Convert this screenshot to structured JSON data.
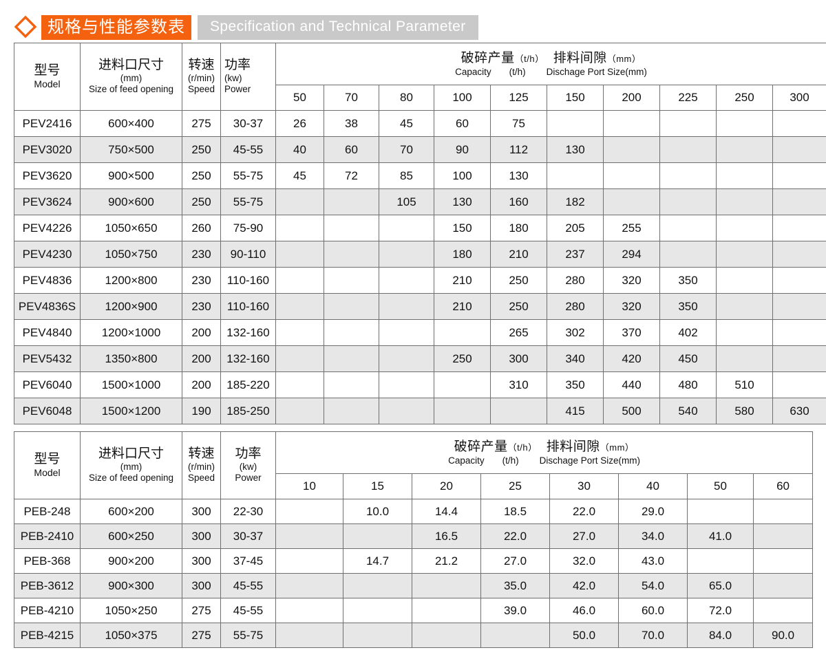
{
  "header": {
    "diamond_icon": "diamond-icon",
    "title_cn": "规格与性能参数表",
    "title_en": "Specification and Technical Parameter",
    "accent_color": "#f4620f",
    "banner_gray": "#c9c9c9"
  },
  "common_headers": {
    "model_cn": "型号",
    "model_en": "Model",
    "feed_cn": "进料口尺寸",
    "feed_unit": "(mm)",
    "feed_en": "Size of feed opening",
    "speed_cn": "转速",
    "speed_unit": "(r/min)",
    "speed_en": "Speed",
    "power_cn": "功率",
    "power_unit": "(kw)",
    "power_en": "Power",
    "capacity_cn": "破碎产量（t/h）",
    "capacity_cn_a": "破碎产量",
    "capacity_cn_unit": "（t/h）",
    "discharge_cn_a": "排料间隙",
    "discharge_cn_unit": "（mm）",
    "capacity_en": "Capacity",
    "capacity_en_unit": "(t/h)",
    "discharge_en": "Dischage Port Size(mm)"
  },
  "table1": {
    "gap_columns": [
      "50",
      "70",
      "80",
      "100",
      "125",
      "150",
      "200",
      "225",
      "250",
      "300"
    ],
    "rows": [
      {
        "model": "PEV2416",
        "feed": "600×400",
        "speed": "275",
        "power": "30-37",
        "values": [
          "26",
          "38",
          "45",
          "60",
          "75",
          "",
          "",
          "",
          "",
          ""
        ]
      },
      {
        "model": "PEV3020",
        "feed": "750×500",
        "speed": "250",
        "power": "45-55",
        "values": [
          "40",
          "60",
          "70",
          "90",
          "112",
          "130",
          "",
          "",
          "",
          ""
        ]
      },
      {
        "model": "PEV3620",
        "feed": "900×500",
        "speed": "250",
        "power": "55-75",
        "values": [
          "45",
          "72",
          "85",
          "100",
          "130",
          "",
          "",
          "",
          "",
          ""
        ]
      },
      {
        "model": "PEV3624",
        "feed": "900×600",
        "speed": "250",
        "power": "55-75",
        "values": [
          "",
          "",
          "105",
          "130",
          "160",
          "182",
          "",
          "",
          "",
          ""
        ]
      },
      {
        "model": "PEV4226",
        "feed": "1050×650",
        "speed": "260",
        "power": "75-90",
        "values": [
          "",
          "",
          "",
          "150",
          "180",
          "205",
          "255",
          "",
          "",
          ""
        ]
      },
      {
        "model": "PEV4230",
        "feed": "1050×750",
        "speed": "230",
        "power": "90-110",
        "values": [
          "",
          "",
          "",
          "180",
          "210",
          "237",
          "294",
          "",
          "",
          ""
        ]
      },
      {
        "model": "PEV4836",
        "feed": "1200×800",
        "speed": "230",
        "power": "110-160",
        "values": [
          "",
          "",
          "",
          "210",
          "250",
          "280",
          "320",
          "350",
          "",
          ""
        ]
      },
      {
        "model": "PEV4836S",
        "feed": "1200×900",
        "speed": "230",
        "power": "110-160",
        "values": [
          "",
          "",
          "",
          "210",
          "250",
          "280",
          "320",
          "350",
          "",
          ""
        ]
      },
      {
        "model": "PEV4840",
        "feed": "1200×1000",
        "speed": "200",
        "power": "132-160",
        "values": [
          "",
          "",
          "",
          "",
          "265",
          "302",
          "370",
          "402",
          "",
          ""
        ]
      },
      {
        "model": "PEV5432",
        "feed": "1350×800",
        "speed": "200",
        "power": "132-160",
        "values": [
          "",
          "",
          "",
          "250",
          "300",
          "340",
          "420",
          "450",
          "",
          ""
        ]
      },
      {
        "model": "PEV6040",
        "feed": "1500×1000",
        "speed": "200",
        "power": "185-220",
        "values": [
          "",
          "",
          "",
          "",
          "310",
          "350",
          "440",
          "480",
          "510",
          ""
        ]
      },
      {
        "model": "PEV6048",
        "feed": "1500×1200",
        "speed": "190",
        "power": "185-250",
        "values": [
          "",
          "",
          "",
          "",
          "",
          "415",
          "500",
          "540",
          "580",
          "630"
        ]
      }
    ]
  },
  "table2": {
    "gap_columns": [
      "10",
      "15",
      "20",
      "25",
      "30",
      "40",
      "50",
      "60"
    ],
    "rows": [
      {
        "model": "PEB-248",
        "feed": "600×200",
        "speed": "300",
        "power": "22-30",
        "values": [
          "",
          "10.0",
          "14.4",
          "18.5",
          "22.0",
          "29.0",
          "",
          ""
        ]
      },
      {
        "model": "PEB-2410",
        "feed": "600×250",
        "speed": "300",
        "power": "30-37",
        "values": [
          "",
          "",
          "16.5",
          "22.0",
          "27.0",
          "34.0",
          "41.0",
          ""
        ]
      },
      {
        "model": "PEB-368",
        "feed": "900×200",
        "speed": "300",
        "power": "37-45",
        "values": [
          "",
          "14.7",
          "21.2",
          "27.0",
          "32.0",
          "43.0",
          "",
          ""
        ]
      },
      {
        "model": "PEB-3612",
        "feed": "900×300",
        "speed": "300",
        "power": "45-55",
        "values": [
          "",
          "",
          "",
          "35.0",
          "42.0",
          "54.0",
          "65.0",
          ""
        ]
      },
      {
        "model": "PEB-4210",
        "feed": "1050×250",
        "speed": "275",
        "power": "45-55",
        "values": [
          "",
          "",
          "",
          "39.0",
          "46.0",
          "60.0",
          "72.0",
          ""
        ]
      },
      {
        "model": "PEB-4215",
        "feed": "1050×375",
        "speed": "275",
        "power": "55-75",
        "values": [
          "",
          "",
          "",
          "",
          "50.0",
          "70.0",
          "84.0",
          "90.0"
        ]
      }
    ]
  }
}
